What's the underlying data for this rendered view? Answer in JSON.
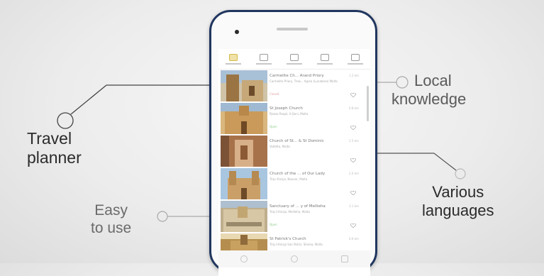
{
  "callouts": {
    "travel_planner": [
      "Travel",
      "planner"
    ],
    "easy_to_use": [
      "Easy",
      "to use"
    ],
    "local_knowledge": [
      "Local",
      "knowledge"
    ],
    "various_languages": [
      "Various",
      "languages"
    ]
  },
  "app": {
    "tabs": [
      "tab-planner",
      "tab-audio",
      "tab-camera",
      "tab-bookmarks",
      "tab-settings"
    ],
    "active_tab": 0,
    "list": [
      {
        "title": "Carmelite Ch... Arand Priory",
        "subtitle": "Carmelite Priory, Trow... Agrea (Lunaboro) Malta",
        "tag": "Closed",
        "distance": "1.2 km"
      },
      {
        "title": "St Joseph Church",
        "subtitle": "Pjazza Reqal, Il-Qoni, Malta",
        "tag": "Open",
        "distance": "0.8 km"
      },
      {
        "title": "Church of St... & St Dominic",
        "subtitle": "Valletta, Malta",
        "tag": "",
        "distance": "1.5 km"
      },
      {
        "title": "Church of the ... of Our Lady",
        "subtitle": "Triq l-Knisja, Naxxar, Malta",
        "tag": "",
        "distance": "2.0 km"
      },
      {
        "title": "Sanctuary of ... y of Mellieha",
        "subtitle": "Triq il-Knisja, Mellieha, Malta",
        "tag": "Open",
        "distance": "3.1 km"
      },
      {
        "title": "St Patrick's Church",
        "subtitle": "Triq il-Knisja San Patriz, Sliema, Malta",
        "tag": "",
        "distance": "0.6 km"
      }
    ]
  },
  "colors": {
    "phone_frame": "#21365f",
    "accent_green": "#7ac27a",
    "accent_red": "#e0a3a3"
  }
}
